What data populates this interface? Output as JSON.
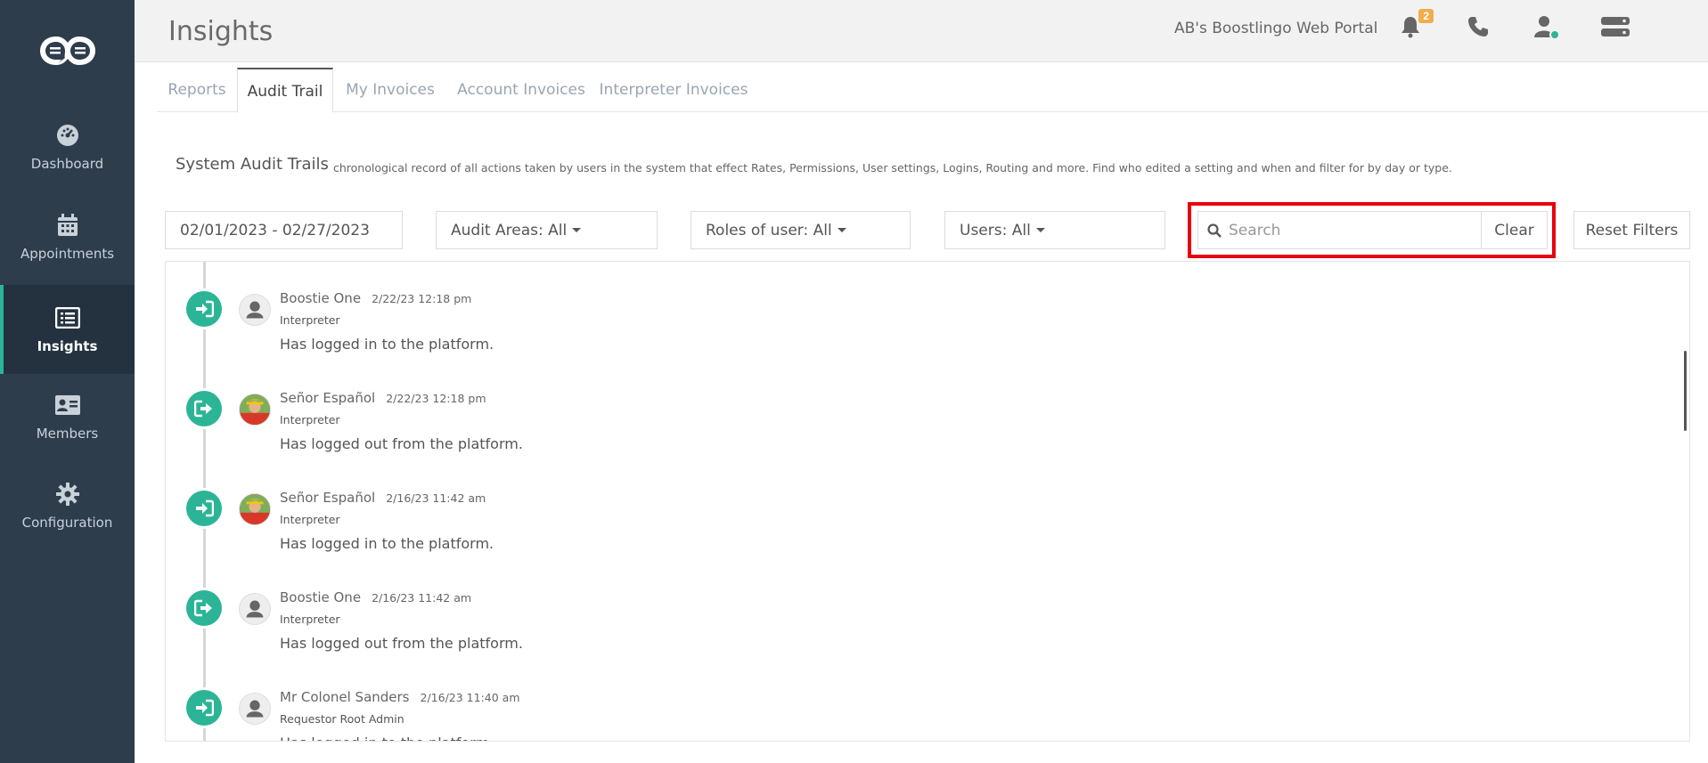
{
  "brand": {
    "logo_icon": "boostlingo-logo-icon"
  },
  "sidebar": {
    "items": [
      {
        "label": "Dashboard",
        "icon": "dashboard-gauge-icon"
      },
      {
        "label": "Appointments",
        "icon": "calendar-icon"
      },
      {
        "label": "Insights",
        "icon": "list-alt-icon",
        "active": true
      },
      {
        "label": "Members",
        "icon": "id-card-icon"
      },
      {
        "label": "Configuration",
        "icon": "gear-icon"
      }
    ]
  },
  "header": {
    "title": "Insights",
    "portal_name": "AB's Boostlingo Web Portal",
    "notifications_count": "2",
    "icons": [
      "bell-icon",
      "phone-icon",
      "user-status-icon",
      "server-icon"
    ]
  },
  "tabs": [
    {
      "label": "Reports"
    },
    {
      "label": "Audit Trail",
      "active": true
    },
    {
      "label": "My Invoices"
    },
    {
      "label": "Account Invoices"
    },
    {
      "label": "Interpreter Invoices"
    }
  ],
  "section": {
    "title": "System Audit Trails",
    "description": "chronological record of all actions taken by users in the system that effect Rates, Permissions, User settings, Logins, Routing and more. Find who edited a setting and when and filter for by day or type."
  },
  "filters": {
    "date_range": "02/01/2023 - 02/27/2023",
    "audit_areas": "Audit Areas: All",
    "roles": "Roles of user: All",
    "users": "Users: All",
    "search_placeholder": "Search",
    "search_value": "",
    "clear_label": "Clear",
    "reset_label": "Reset Filters"
  },
  "colors": {
    "accent": "#2bb596",
    "sidebar_bg": "#2e3d4c",
    "highlight": "#e8000b",
    "badge": "#f0ad4e"
  },
  "entries": [
    {
      "name": "Boostie One",
      "time": "2/22/23 12:18 pm",
      "role": "Interpreter",
      "message": "Has logged in to the platform.",
      "action": "login",
      "avatar": "default"
    },
    {
      "name": "Señor Español",
      "time": "2/22/23 12:18 pm",
      "role": "Interpreter",
      "message": "Has logged out from the platform.",
      "action": "logout",
      "avatar": "photo"
    },
    {
      "name": "Señor Español",
      "time": "2/16/23 11:42 am",
      "role": "Interpreter",
      "message": "Has logged in to the platform.",
      "action": "login",
      "avatar": "photo"
    },
    {
      "name": "Boostie One",
      "time": "2/16/23 11:42 am",
      "role": "Interpreter",
      "message": "Has logged out from the platform.",
      "action": "logout",
      "avatar": "default"
    },
    {
      "name": "Mr Colonel Sanders",
      "time": "2/16/23 11:40 am",
      "role": "Requestor Root Admin",
      "message": "Has logged in to the platform.",
      "action": "login",
      "avatar": "default"
    }
  ]
}
